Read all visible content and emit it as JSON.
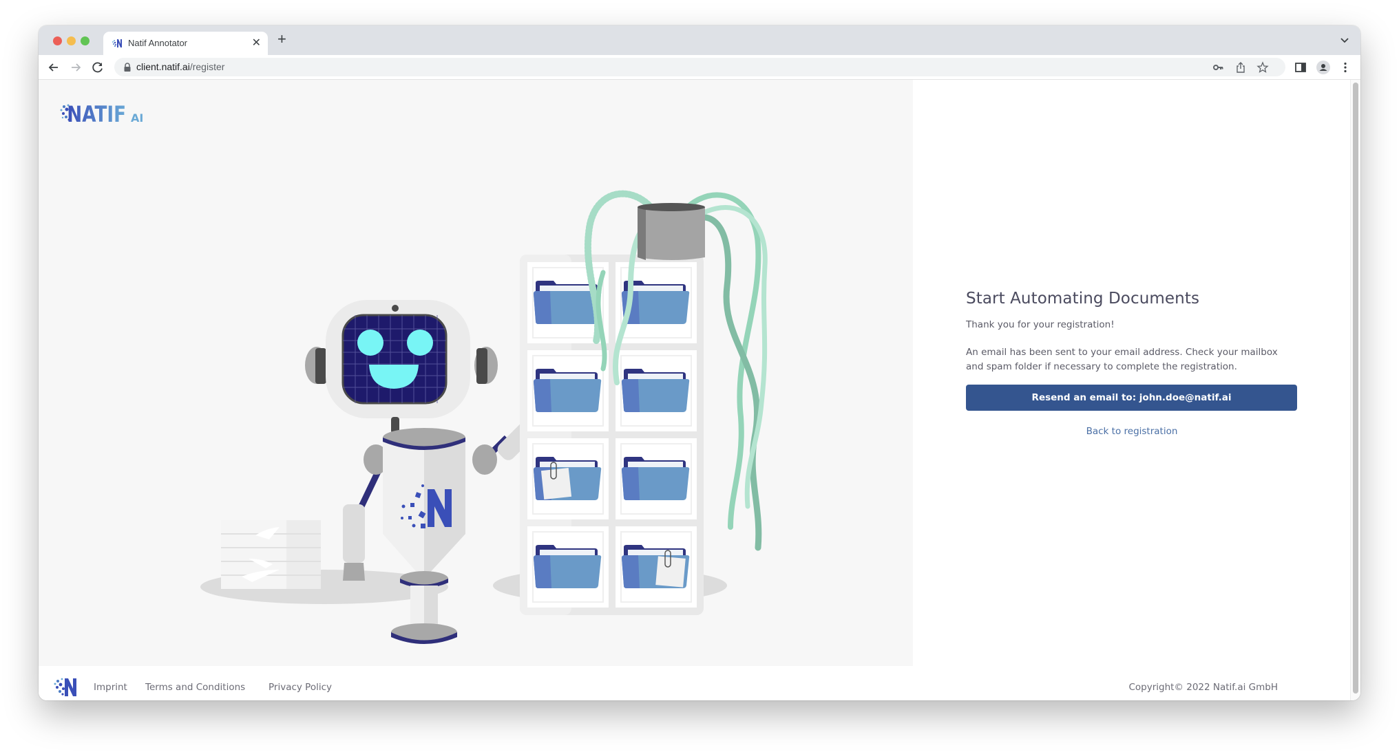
{
  "browser": {
    "tab": {
      "title": "Natif Annotator",
      "favicon": "natif-logo-icon",
      "close_icon": "close-icon"
    },
    "new_tab_icon": "plus-icon",
    "tab_list_icon": "chevron-down-icon",
    "nav": {
      "back_icon": "arrow-left-icon",
      "forward_icon": "arrow-right-icon",
      "reload_icon": "reload-icon"
    },
    "address_bar": {
      "lock_icon": "lock-icon",
      "domain": "client.natif.ai",
      "path": "/register"
    },
    "omnibox_icons": [
      "key-icon",
      "share-icon",
      "star-icon"
    ],
    "toolbar_icons": [
      "sidebar-icon",
      "profile-icon",
      "menu-dots-icon"
    ],
    "traffic_lights": {
      "close": "#ec5f57",
      "minimize": "#f5bd4f",
      "maximize": "#61c454"
    }
  },
  "logo": {
    "text": "NATIF",
    "suffix": "AI"
  },
  "main": {
    "heading": "Start Automating Documents",
    "thanks": "Thank you for your registration!",
    "info": "An email has been sent to your email address. Check your mailbox and spam folder if necessary to complete the registration.",
    "resend_button": "Resend an email to: john.doe@natif.ai",
    "back_link": "Back to registration"
  },
  "footer": {
    "links": [
      "Imprint",
      "Terms and Conditions",
      "Privacy Policy"
    ],
    "copyright": "Copyright© 2022 Natif.ai GmbH"
  },
  "colors": {
    "primary": "#34558f",
    "link": "#4a6fa5",
    "heading": "#4a4a5e",
    "brand_dark": "#3a4fb8",
    "brand_light": "#6aa9d6"
  }
}
